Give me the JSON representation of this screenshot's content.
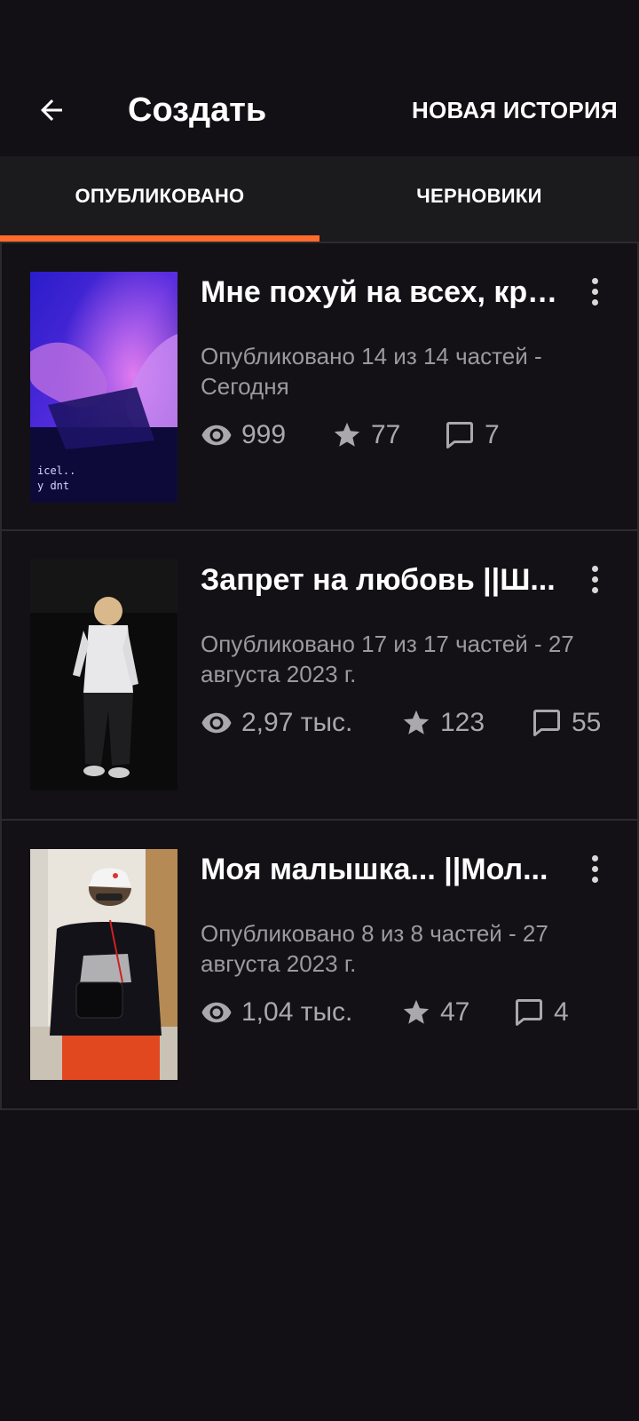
{
  "header": {
    "title": "Создать",
    "new_story": "НОВАЯ ИСТОРИЯ"
  },
  "tabs": [
    {
      "label": "ОПУБЛИКОВАНО",
      "active": true
    },
    {
      "label": "ЧЕРНОВИКИ",
      "active": false
    }
  ],
  "colors": {
    "accent": "#ff6b2c",
    "background": "#121014",
    "tab_bar": "#1b1a1d",
    "muted_text": "#9b9a9e"
  },
  "stories": [
    {
      "title": "Мне похуй на всех, кро...",
      "meta": "Опубликовано 14 из 14 частей - Сегодня",
      "views": "999",
      "votes": "77",
      "comments": "7"
    },
    {
      "title": "Запрет на любовь ||Ш...",
      "meta": "Опубликовано 17 из 17 частей - 27 августа 2023 г.",
      "views": "2,97 тыс.",
      "votes": "123",
      "comments": "55"
    },
    {
      "title": "Моя малышка... ||Мол...",
      "meta": "Опубликовано 8 из 8 частей - 27 августа 2023 г.",
      "views": "1,04 тыс.",
      "votes": "47",
      "comments": "4"
    }
  ],
  "icons": {
    "back": "arrow-left-icon",
    "views": "eye-icon",
    "votes": "star-icon",
    "comments": "comment-icon",
    "menu": "more-vertical-icon"
  }
}
